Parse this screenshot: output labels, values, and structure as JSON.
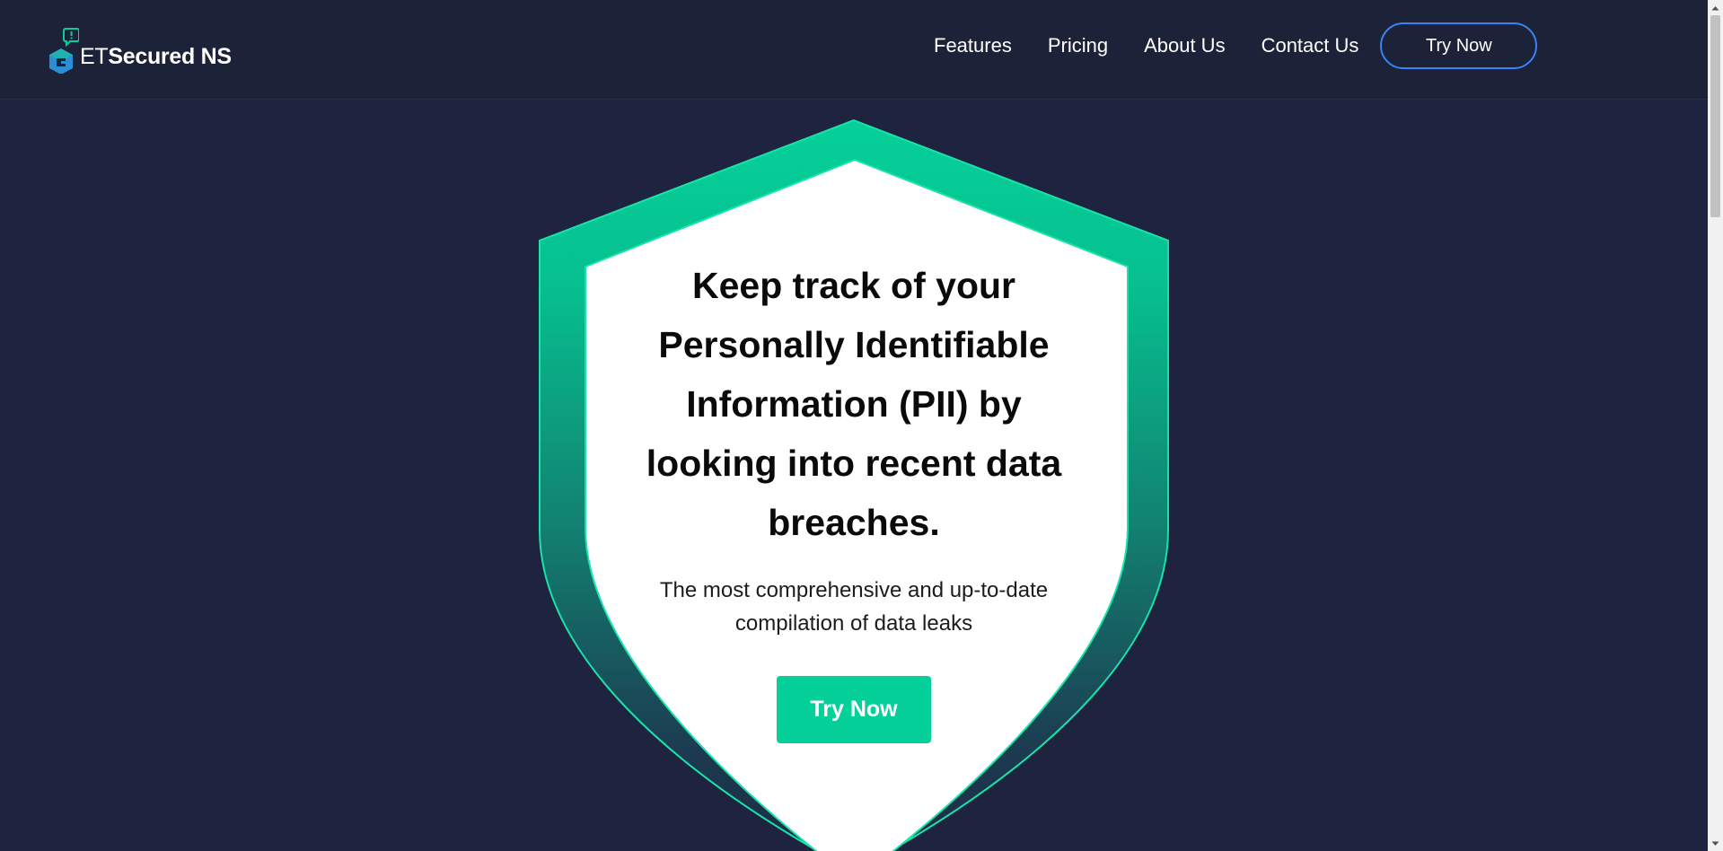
{
  "brand": {
    "logo_letter": "G",
    "logo_et": "ET",
    "logo_rest": "Secured NS",
    "logo_bubble_glyph": "!",
    "accent_color": "#06d09a",
    "logo_blue": "#2b8fd6"
  },
  "nav": {
    "items": [
      {
        "label": "Features"
      },
      {
        "label": "Pricing"
      },
      {
        "label": "About Us"
      },
      {
        "label": "Contact Us"
      }
    ],
    "cta_label": "Try Now",
    "cta_border_color": "#3b82f6"
  },
  "hero": {
    "title": "Keep track of your Personally Identifiable Information (PII) by looking into recent data breaches.",
    "subtitle": "The most comprehensive and up-to-date compilation of data leaks",
    "cta_label": "Try Now",
    "shield_top_color": "#06d09a",
    "shield_bottom_color": "#1e2a44"
  },
  "colors": {
    "page_background": "#1e2440",
    "header_background": "#1c2238",
    "text_on_dark": "#ffffff"
  },
  "scrollbar": {
    "up_arrow_icon": "▲",
    "down_arrow_icon": "▼"
  }
}
